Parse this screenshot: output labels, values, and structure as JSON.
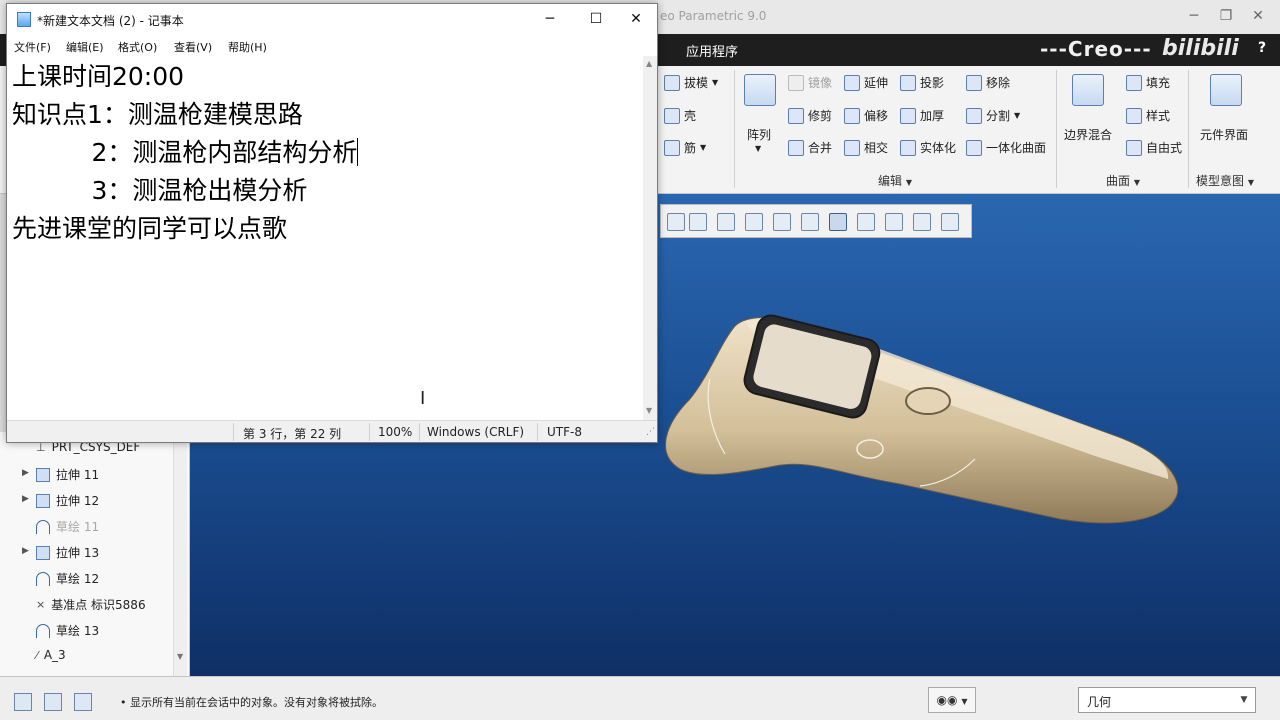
{
  "notepad": {
    "title": "*新建文本文档 (2) - 记事本",
    "window_controls": {
      "minimize": "─",
      "maximize": "☐",
      "close": "✕"
    },
    "menu": [
      "文件(F)",
      "编辑(E)",
      "格式(O)",
      "查看(V)",
      "帮助(H)"
    ],
    "lines": [
      "上课时间20:00",
      "知识点1：测温枪建模思路",
      "          2：测温枪内部结构分析",
      "          3：测温枪出模分析",
      "先进课堂的同学可以点歌"
    ],
    "status": {
      "position": "第 3 行，第 22 列",
      "zoom": "100%",
      "line_ending": "Windows (CRLF)",
      "encoding": "UTF-8"
    }
  },
  "creo": {
    "title_partial": "eo Parametric 9.0",
    "window_controls": {
      "minimize": "─",
      "restore": "❐",
      "close": "✕"
    },
    "app_tab": "应用程序",
    "brand": "---Creo---",
    "watermark": "bilibili",
    "help": "?",
    "ribbon": {
      "left_items": [
        "拔模",
        "壳",
        "筋"
      ],
      "pattern": "阵列",
      "edit_col1": [
        "镜像",
        "修剪",
        "合并"
      ],
      "edit_col2": [
        "延伸",
        "偏移",
        "相交"
      ],
      "edit_col3": [
        "投影",
        "加厚",
        "实体化"
      ],
      "edit_col4": [
        "移除",
        "分割",
        "一体化曲面"
      ],
      "edit_group": "编辑",
      "blend": "边界混合",
      "surface_items": [
        "填充",
        "样式",
        "自由式"
      ],
      "surface_group": "曲面",
      "component_interface": "元件界面",
      "model_intent_group": "模型意图"
    },
    "model_tree": [
      {
        "label": "PRT_CSYS_DEF",
        "kind": "csys",
        "expandable": false,
        "dim": false
      },
      {
        "label": "拉伸 11",
        "kind": "extrude",
        "expandable": true,
        "dim": false
      },
      {
        "label": "拉伸 12",
        "kind": "extrude",
        "expandable": true,
        "dim": false
      },
      {
        "label": "草绘 11",
        "kind": "sketch",
        "expandable": false,
        "dim": true
      },
      {
        "label": "拉伸 13",
        "kind": "extrude",
        "expandable": true,
        "dim": false
      },
      {
        "label": "草绘 12",
        "kind": "sketch",
        "expandable": false,
        "dim": false
      },
      {
        "label": "基准点 标识5886",
        "kind": "point",
        "expandable": false,
        "dim": false
      },
      {
        "label": "草绘 13",
        "kind": "sketch",
        "expandable": false,
        "dim": false
      },
      {
        "label": "A_3",
        "kind": "axis",
        "expandable": false,
        "dim": false
      }
    ],
    "status_message": "• 显示所有当前在会话中的对象。没有对象将被拭除。",
    "find_icon": "binoculars-icon",
    "filter_value": "几何"
  },
  "colors": {
    "graphics_top": "#2a67b0",
    "graphics_bottom": "#0f2f66",
    "model_body": "#d9c7a6",
    "ribbon_bg": "#f3f3f3"
  }
}
